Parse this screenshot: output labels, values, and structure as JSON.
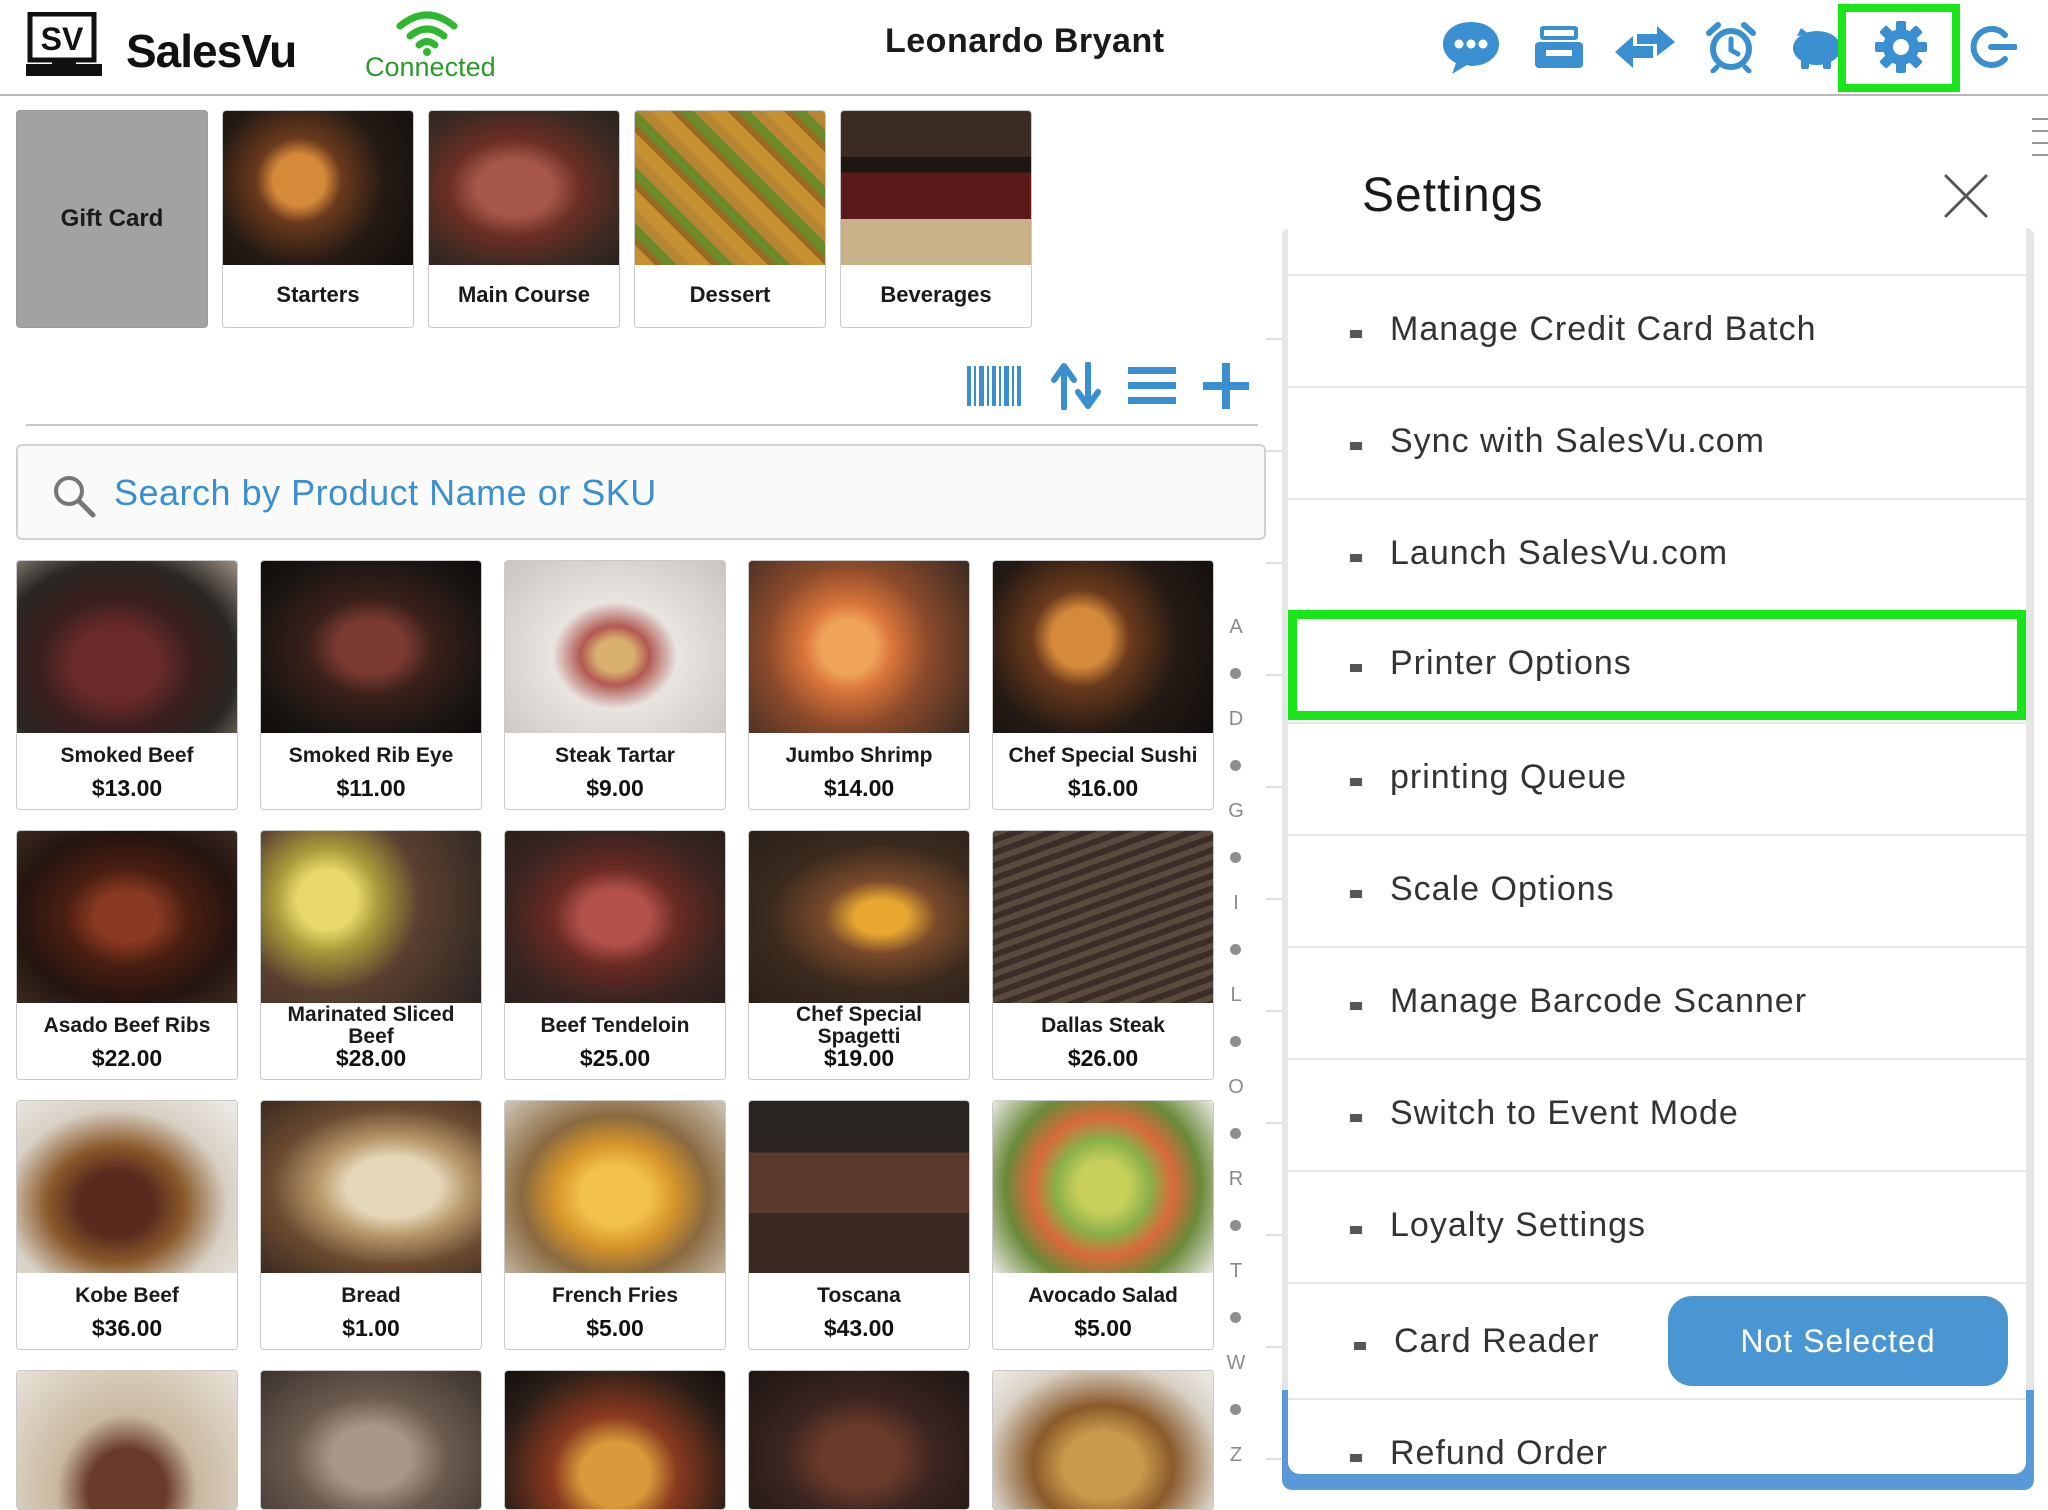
{
  "app": {
    "logo_badge": "SV",
    "logo_text": "SalesVu",
    "connection_status": "Connected",
    "user_name": "Leonardo Bryant"
  },
  "toolbar_icons": [
    "chat-icon",
    "register-icon",
    "transfer-icon",
    "alarm-clock-icon",
    "piggy-bank-icon",
    "gear-icon",
    "logout-icon"
  ],
  "categories": [
    {
      "label": "Gift Card"
    },
    {
      "label": "Starters"
    },
    {
      "label": "Main Course"
    },
    {
      "label": "Dessert"
    },
    {
      "label": "Beverages"
    }
  ],
  "list_tools": [
    "barcode-icon",
    "sort-icon",
    "list-view-icon",
    "add-icon"
  ],
  "search": {
    "placeholder": "Search by Product Name or SKU"
  },
  "products": [
    {
      "name": "Smoked Beef",
      "price": "$13.00"
    },
    {
      "name": "Smoked Rib Eye",
      "price": "$11.00"
    },
    {
      "name": "Steak Tartar",
      "price": "$9.00"
    },
    {
      "name": "Jumbo Shrimp",
      "price": "$14.00"
    },
    {
      "name": "Chef Special Sushi",
      "price": "$16.00"
    },
    {
      "name": "Asado Beef Ribs",
      "price": "$22.00"
    },
    {
      "name": "Marinated Sliced Beef",
      "price": "$28.00"
    },
    {
      "name": "Beef Tendeloin",
      "price": "$25.00"
    },
    {
      "name": "Chef Special Spagetti",
      "price": "$19.00"
    },
    {
      "name": "Dallas Steak",
      "price": "$26.00"
    },
    {
      "name": "Kobe Beef",
      "price": "$36.00"
    },
    {
      "name": "Bread",
      "price": "$1.00"
    },
    {
      "name": "French Fries",
      "price": "$5.00"
    },
    {
      "name": "Toscana",
      "price": "$43.00"
    },
    {
      "name": "Avocado Salad",
      "price": "$5.00"
    }
  ],
  "alphabet_index": [
    "A",
    "D",
    "G",
    "I",
    "L",
    "O",
    "R",
    "T",
    "W",
    "Z"
  ],
  "settings": {
    "title": "Settings",
    "items": [
      {
        "label": "Manage Credit Card Batch"
      },
      {
        "label": "Sync with SalesVu.com"
      },
      {
        "label": "Launch SalesVu.com"
      },
      {
        "label": "Printer Options"
      },
      {
        "label": "printing Queue"
      },
      {
        "label": "Scale Options"
      },
      {
        "label": "Manage Barcode Scanner"
      },
      {
        "label": "Switch to Event Mode"
      },
      {
        "label": "Loyalty Settings"
      },
      {
        "label": "Card Reader"
      },
      {
        "label": "Refund Order"
      }
    ],
    "card_reader_button": "Not Selected"
  },
  "colors": {
    "icon_blue": "#3a8fd0",
    "connected_green": "#2a9b2a",
    "highlight_green": "#19e619",
    "button_blue": "#4a96d2"
  }
}
